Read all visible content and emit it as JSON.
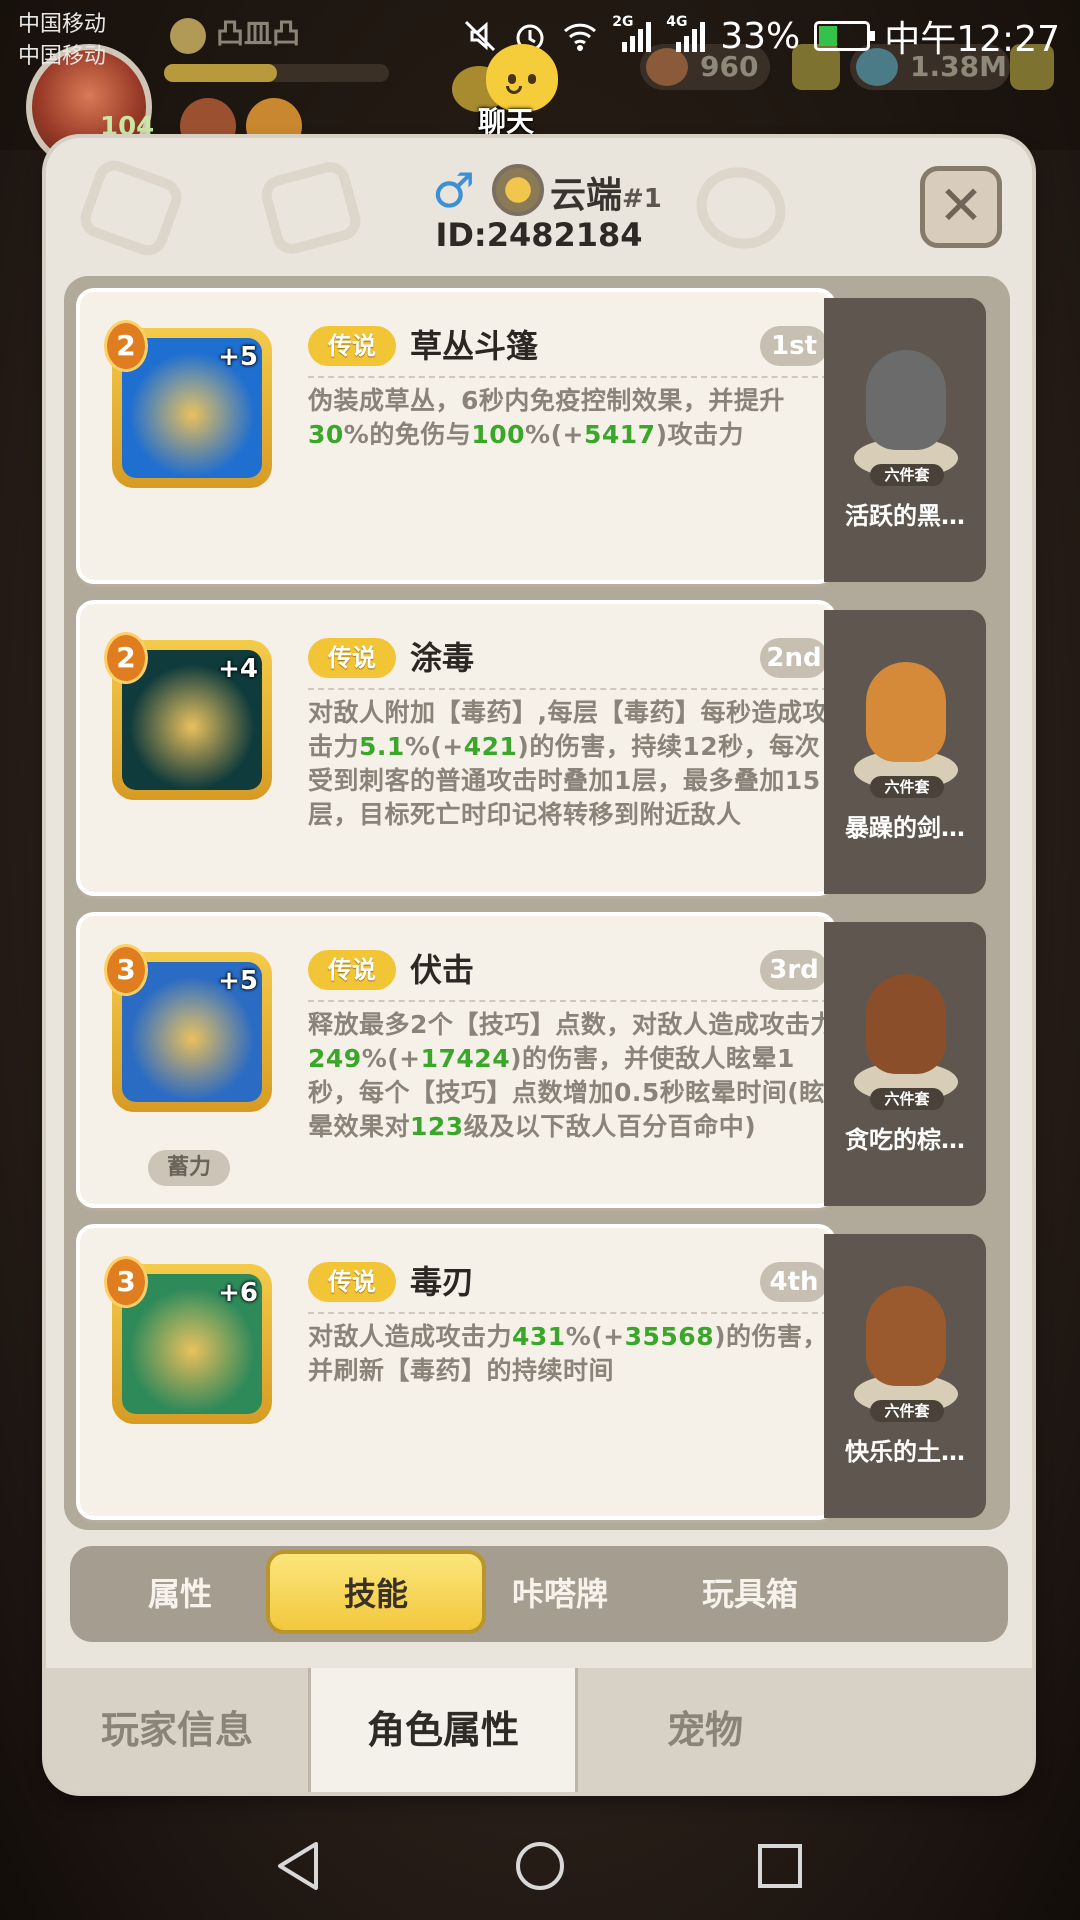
{
  "status_bar": {
    "carrier_1": "中国移动",
    "carrier_2": "中国移动",
    "signal_2g": "2G",
    "signal_4g": "4G",
    "battery": "33%",
    "time": "中午12:27"
  },
  "background_hud": {
    "player_name": "凸皿凸",
    "level": "104",
    "coins": "960",
    "gems": "1.38M"
  },
  "chat": {
    "label": "聊天"
  },
  "profile": {
    "name": "云端",
    "rank": "#1",
    "id_text": "ID:2482184"
  },
  "skills": [
    {
      "level": "2",
      "plus": "+5",
      "tag": "传说",
      "name": "草丛斗篷",
      "rank": "1st",
      "desc": [
        {
          "t": "伪装成草丛，6秒内免疫控制效果，并提升"
        },
        {
          "t": "30",
          "g": true
        },
        {
          "t": "%的免伤与"
        },
        {
          "t": "100",
          "g": true
        },
        {
          "t": "%(+"
        },
        {
          "t": "5417",
          "g": true
        },
        {
          "t": ")攻击力"
        }
      ],
      "pet_set": "六件套",
      "pet_name": "活跃的黑…",
      "colors": {
        "icon_bg": "#1f6fd0",
        "pet": "#6b6b6b"
      }
    },
    {
      "level": "2",
      "plus": "+4",
      "tag": "传说",
      "name": "涂毒",
      "rank": "2nd",
      "desc": [
        {
          "t": "对敌人附加【毒药】,每层【毒药】每秒造成攻击力"
        },
        {
          "t": "5.1",
          "g": true
        },
        {
          "t": "%(+"
        },
        {
          "t": "421",
          "g": true
        },
        {
          "t": ")的伤害，持续12秒，每次受到刺客的普通攻击时叠加1层，最多叠加15层，目标死亡时印记将转移到附近敌人"
        }
      ],
      "pet_set": "六件套",
      "pet_name": "暴躁的剑…",
      "colors": {
        "icon_bg": "#0f3b3c",
        "pet": "#d58a3a"
      }
    },
    {
      "level": "3",
      "plus": "+5",
      "tag": "传说",
      "name": "伏击",
      "rank": "3rd",
      "desc": [
        {
          "t": "释放最多2个【技巧】点数，对敌人造成攻击力"
        },
        {
          "t": "249",
          "g": true
        },
        {
          "t": "%(+"
        },
        {
          "t": "17424",
          "g": true
        },
        {
          "t": ")的伤害，并使敌人眩晕1秒，每个【技巧】点数增加0.5秒眩晕时间(眩晕效果对"
        },
        {
          "t": "123",
          "g": true
        },
        {
          "t": "级及以下敌人百分百命中)"
        }
      ],
      "charge_label": "蓄力",
      "pet_set": "六件套",
      "pet_name": "贪吃的棕…",
      "colors": {
        "icon_bg": "#2a6bc4",
        "pet": "#8a4e2a"
      }
    },
    {
      "level": "3",
      "plus": "+6",
      "tag": "传说",
      "name": "毒刃",
      "rank": "4th",
      "desc": [
        {
          "t": "对敌人造成攻击力"
        },
        {
          "t": "431",
          "g": true
        },
        {
          "t": "%(+"
        },
        {
          "t": "35568",
          "g": true
        },
        {
          "t": ")的伤害，并刷新【毒药】的持续时间"
        }
      ],
      "pet_set": "六件套",
      "pet_name": "快乐的土…",
      "colors": {
        "icon_bg": "#2f8a5a",
        "pet": "#9a5a2e"
      }
    }
  ],
  "sub_tabs": [
    "属性",
    "技能",
    "咔嗒牌",
    "玩具箱"
  ],
  "sub_tab_active": 1,
  "bottom_tabs": [
    "玩家信息",
    "角色属性",
    "宠物"
  ],
  "bottom_tab_active": 1,
  "accent_colors": {
    "gold": "#f1c535",
    "green_value": "#3aa72b",
    "panel": "#eae5dc"
  }
}
